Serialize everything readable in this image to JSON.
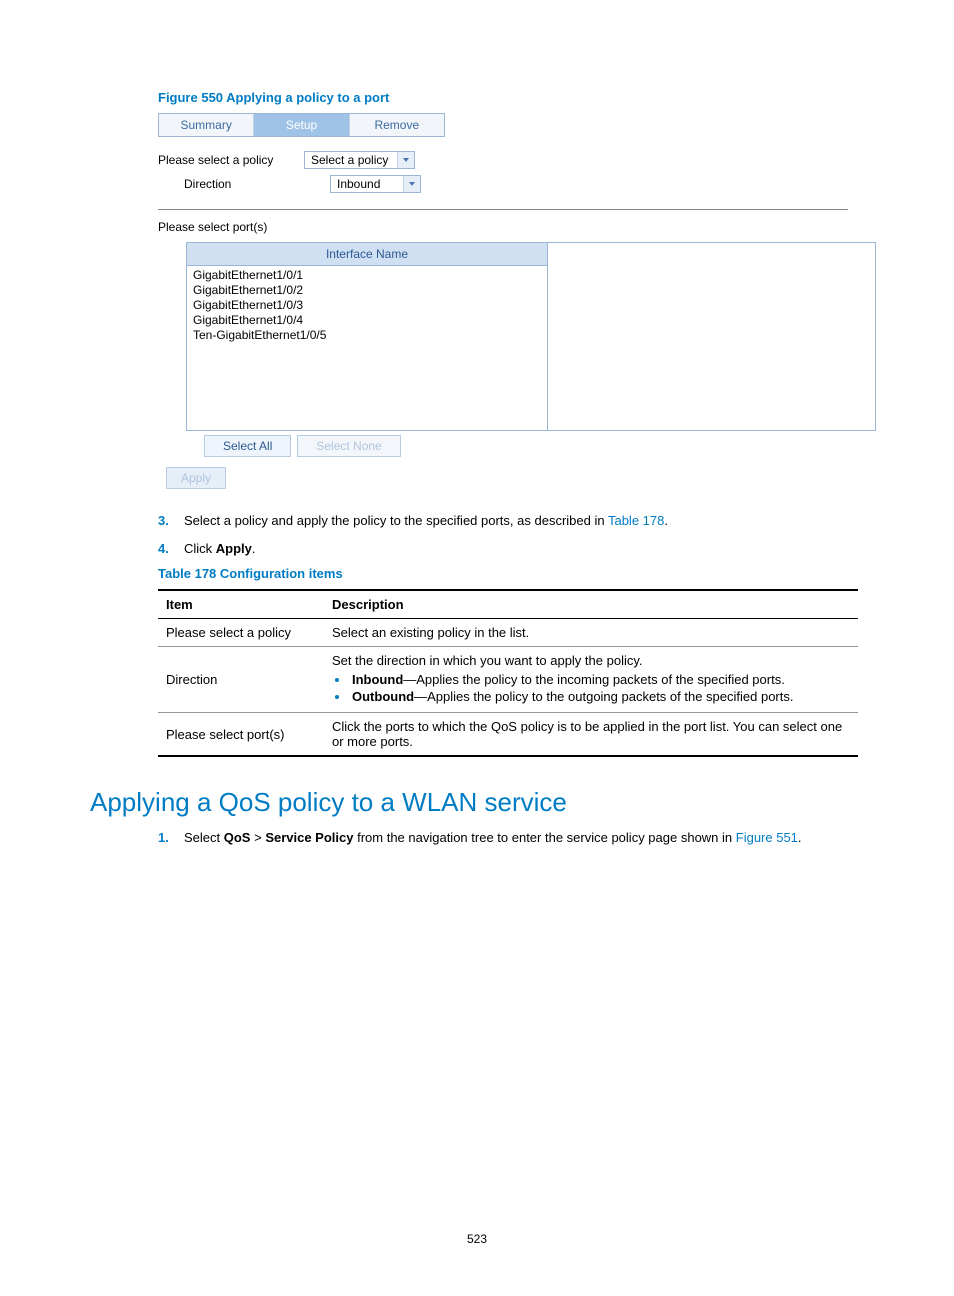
{
  "figure_caption": "Figure 550 Applying a policy to a port",
  "tabs": {
    "summary": "Summary",
    "setup": "Setup",
    "remove": "Remove"
  },
  "form": {
    "policy_label": "Please select a policy",
    "policy_value": "Select a policy",
    "direction_label": "Direction",
    "direction_value": "Inbound"
  },
  "ports_label": "Please select port(s)",
  "ports_header": "Interface Name",
  "ports": [
    "GigabitEthernet1/0/1",
    "GigabitEthernet1/0/2",
    "GigabitEthernet1/0/3",
    "GigabitEthernet1/0/4",
    "Ten-GigabitEthernet1/0/5"
  ],
  "buttons": {
    "select_all": "Select All",
    "select_none": "Select None",
    "apply": "Apply"
  },
  "step3": {
    "num": "3.",
    "text_a": "Select a policy and apply the policy to the specified ports, as described in ",
    "link": "Table 178",
    "text_b": "."
  },
  "step4": {
    "num": "4.",
    "text_a": "Click ",
    "bold": "Apply",
    "text_b": "."
  },
  "table_caption": "Table 178 Configuration items",
  "table_headers": {
    "item": "Item",
    "desc": "Description"
  },
  "row1": {
    "item": "Please select a policy",
    "desc": "Select an existing policy in the list."
  },
  "row2": {
    "item": "Direction",
    "intro": "Set the direction in which you want to apply the policy.",
    "li1_b": "Inbound",
    "li1_t": "—Applies the policy to the incoming packets of the specified ports.",
    "li2_b": "Outbound",
    "li2_t": "—Applies the policy to the outgoing packets of the specified ports."
  },
  "row3": {
    "item": "Please select port(s)",
    "desc": "Click the ports to which the QoS policy is to be applied in the port list. You can select one or more ports."
  },
  "heading": "Applying a QoS policy to a WLAN service",
  "step1": {
    "num": "1.",
    "a": "Select ",
    "b1": "QoS",
    "gt": " > ",
    "b2": "Service Policy",
    "c": " from the navigation tree to enter the service policy page shown in ",
    "link": "Figure 551",
    "d": "."
  },
  "page_number": "523"
}
